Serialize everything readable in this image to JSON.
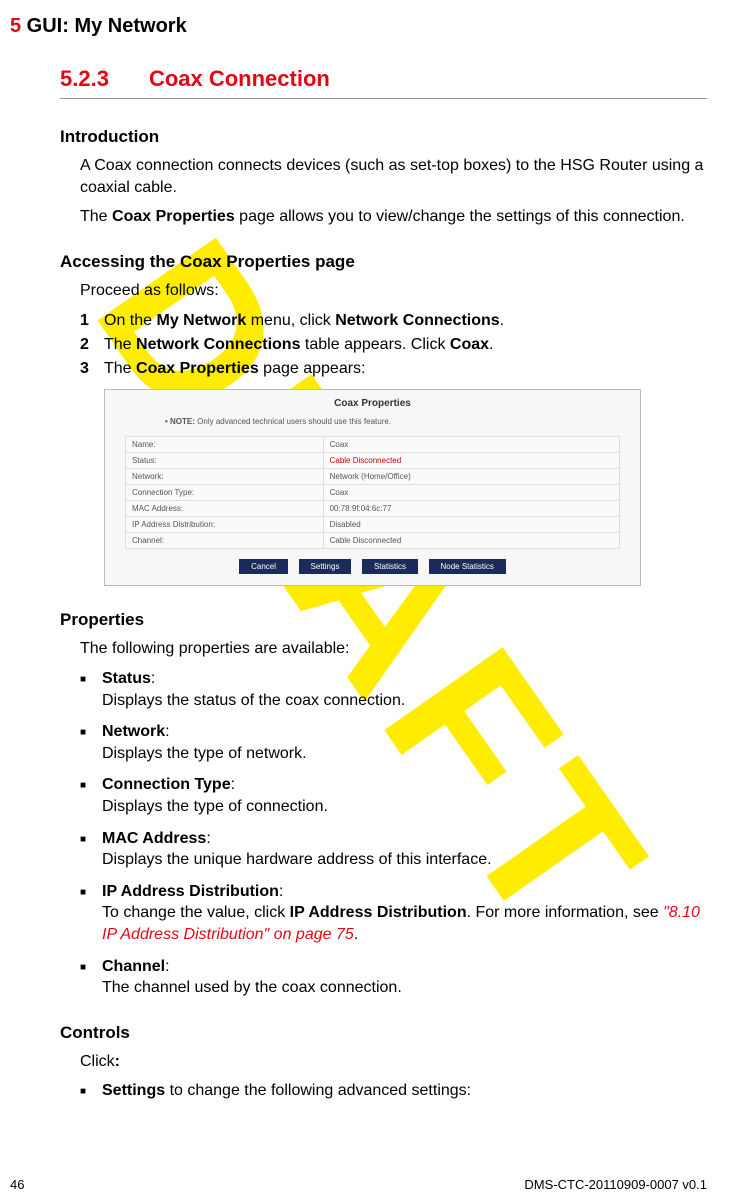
{
  "watermark": "DRAFT",
  "header": {
    "chapter_num": "5",
    "chapter_title": " GUI: My Network"
  },
  "section": {
    "number": "5.2.3",
    "title": "Coax Connection"
  },
  "intro": {
    "heading": "Introduction",
    "p1": "A Coax connection connects devices (such as set-top boxes) to the HSG Router using a coaxial cable.",
    "p2_a": "The ",
    "p2_b": "Coax Properties",
    "p2_c": " page allows you to view/change the settings of this connection."
  },
  "accessing": {
    "heading": "Accessing the Coax Properties page",
    "lead": "Proceed as follows:",
    "steps": [
      {
        "num": "1",
        "a": "On the ",
        "b": "My Network",
        "c": " menu, click ",
        "d": "Network Connections",
        "e": "."
      },
      {
        "num": "2",
        "a": "The ",
        "b": "Network Connections",
        "c": " table appears. Click ",
        "d": "Coax",
        "e": "."
      },
      {
        "num": "3",
        "a": "The ",
        "b": "Coax Properties",
        "c": " page appears:"
      }
    ]
  },
  "screenshot": {
    "title": "Coax Properties",
    "note_prefix": "• NOTE: ",
    "note": "Only advanced technical users should use this feature.",
    "rows": [
      {
        "label": "Name:",
        "value": "Coax"
      },
      {
        "label": "Status:",
        "value": "Cable Disconnected",
        "red": true
      },
      {
        "label": "Network:",
        "value": "Network (Home/Office)"
      },
      {
        "label": "Connection Type:",
        "value": "Coax"
      },
      {
        "label": "MAC Address:",
        "value": "00:78:9f:04:6c:77"
      },
      {
        "label": "IP Address Distribution:",
        "value": "Disabled"
      },
      {
        "label": "Channel:",
        "value": "Cable Disconnected"
      }
    ],
    "buttons": [
      "Cancel",
      "Settings",
      "Statistics",
      "Node Statistics"
    ]
  },
  "properties": {
    "heading": "Properties",
    "lead": "The following properties are available:",
    "items": [
      {
        "name": "Status",
        "desc": "Displays the status of the coax connection."
      },
      {
        "name": "Network",
        "desc": "Displays the type of network."
      },
      {
        "name": "Connection Type",
        "desc": "Displays the type of connection."
      },
      {
        "name": "MAC Address",
        "desc": "Displays the unique hardware address of this interface."
      },
      {
        "name": "IP Address Distribution",
        "desc_a": "To change the value, click ",
        "desc_b": "IP Address Distribution",
        "desc_c": ". For more information, see ",
        "xref": "\"8.10 IP Address Distribution\" on page 75",
        "desc_d": "."
      },
      {
        "name": "Channel",
        "desc": "The channel used by the coax connection."
      }
    ]
  },
  "controls": {
    "heading": "Controls",
    "lead_a": "Click",
    "lead_b": ":",
    "items": [
      {
        "name": "Settings",
        "desc": " to change the following advanced settings:"
      }
    ]
  },
  "footer": {
    "page_num": "46",
    "doc_id": "DMS-CTC-20110909-0007 v0.1"
  }
}
